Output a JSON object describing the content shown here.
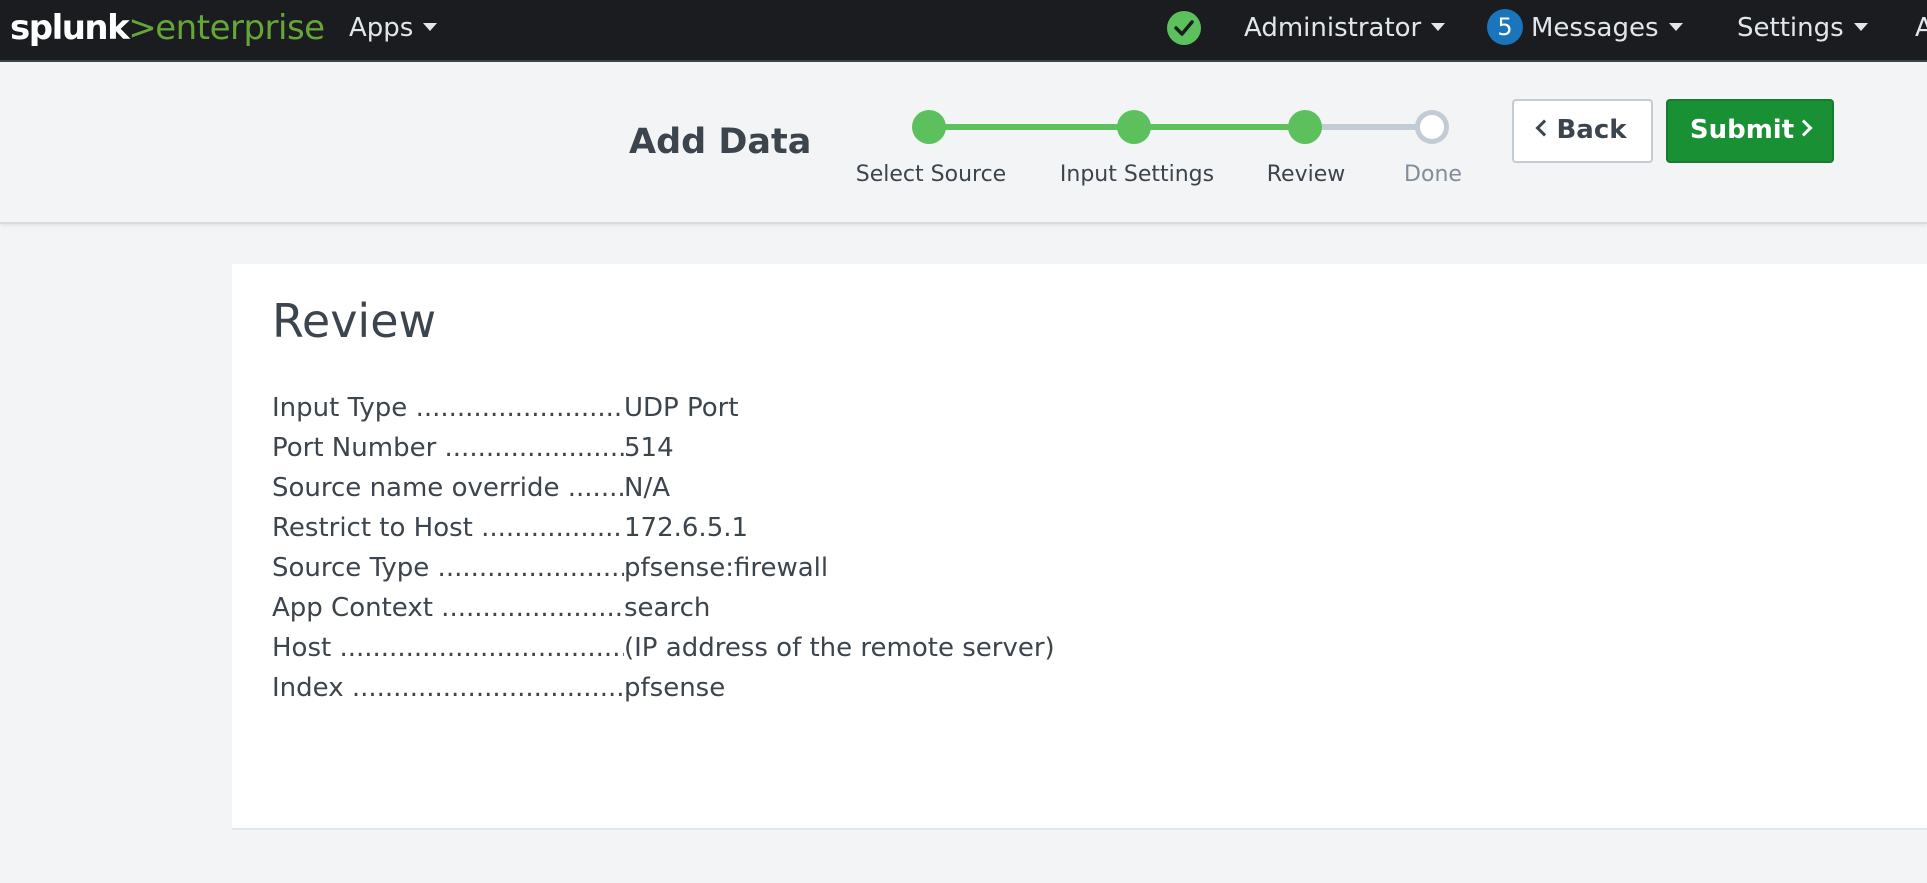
{
  "topbar": {
    "logo_main": "splunk",
    "logo_gt": ">",
    "logo_product": "enterprise",
    "apps_label": "Apps",
    "user_label": "Administrator",
    "messages_count": "5",
    "messages_label": "Messages",
    "settings_label": "Settings",
    "overflow_label": "A"
  },
  "header": {
    "title": "Add Data",
    "steps": [
      {
        "label": "Select Source",
        "state": "done"
      },
      {
        "label": "Input Settings",
        "state": "done"
      },
      {
        "label": "Review",
        "state": "done"
      },
      {
        "label": "Done",
        "state": "todo"
      }
    ],
    "back_label": "Back",
    "submit_label": "Submit"
  },
  "review": {
    "title": "Review",
    "rows": [
      {
        "label": "Input Type",
        "value": "UDP Port"
      },
      {
        "label": "Port Number",
        "value": "514"
      },
      {
        "label": "Source name override",
        "value": "N/A"
      },
      {
        "label": "Restrict to Host",
        "value": "172.6.5.1"
      },
      {
        "label": "Source Type",
        "value": "pfsense:firewall"
      },
      {
        "label": "App Context",
        "value": "search"
      },
      {
        "label": "Host",
        "value": "(IP address of the remote server)"
      },
      {
        "label": "Index",
        "value": "pfsense"
      }
    ]
  },
  "colors": {
    "accent_green": "#5cc05c",
    "submit_green": "#1a9035",
    "badge_blue": "#1a75bc",
    "topbar_bg": "#1a1c20"
  }
}
